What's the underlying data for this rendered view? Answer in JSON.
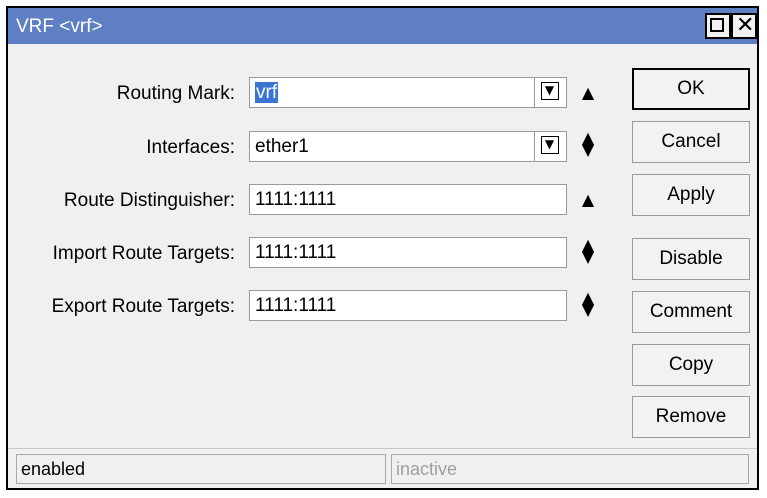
{
  "window": {
    "title": "VRF <vrf>"
  },
  "form": {
    "routing_mark": {
      "label": "Routing Mark:",
      "value": "vrf"
    },
    "interfaces": {
      "label": "Interfaces:",
      "value": "ether1"
    },
    "route_distinguisher": {
      "label": "Route Distinguisher:",
      "value": "1111:1111"
    },
    "import_route_targets": {
      "label": "Import Route Targets:",
      "value": "1111:1111"
    },
    "export_route_targets": {
      "label": "Export Route Targets:",
      "value": "1111:1111"
    }
  },
  "buttons": {
    "ok": "OK",
    "cancel": "Cancel",
    "apply": "Apply",
    "disable": "Disable",
    "comment": "Comment",
    "copy": "Copy",
    "remove": "Remove"
  },
  "status": {
    "left": "enabled",
    "right": "inactive"
  },
  "icons": {
    "maximize": "maximize-icon",
    "close": "close-icon",
    "dropdown": "dropdown-icon",
    "collapse": "triangle-up-icon",
    "updown": "up-down-icon"
  },
  "colors": {
    "titlebar": "#5e7fc4",
    "selection": "#3a75d4"
  }
}
